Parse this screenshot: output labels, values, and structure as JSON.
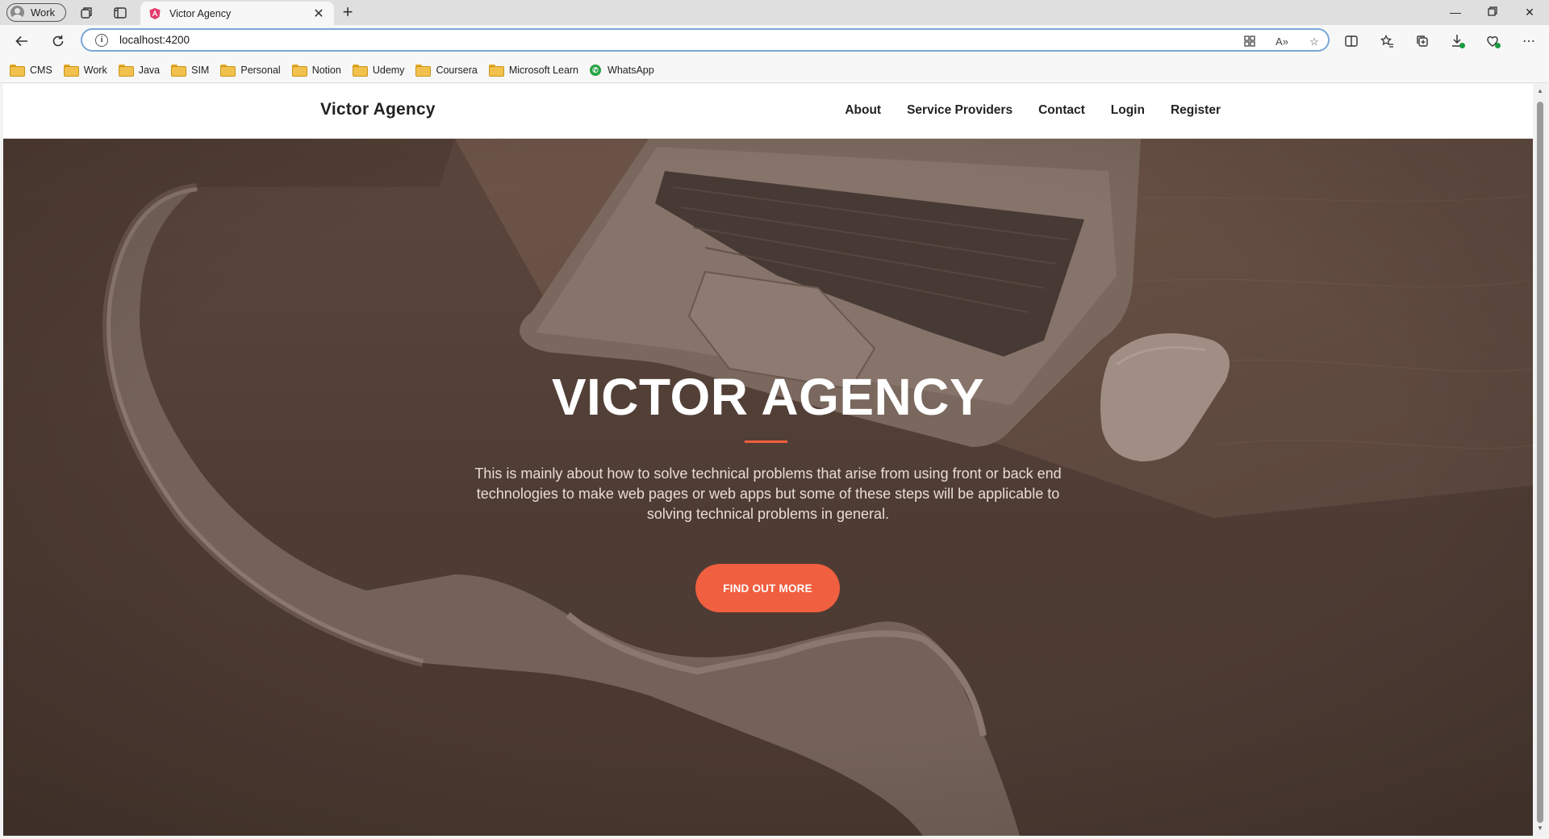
{
  "browser": {
    "profile_label": "Work",
    "tab_title": "Victor Agency",
    "address_url": "localhost:4200",
    "bookmarks": [
      "CMS",
      "Work",
      "Java",
      "SIM",
      "Personal",
      "Notion",
      "Udemy",
      "Coursera",
      "Microsoft Learn",
      "WhatsApp"
    ]
  },
  "site": {
    "brand": "Victor Agency",
    "nav": [
      "About",
      "Service Providers",
      "Contact",
      "Login",
      "Register"
    ]
  },
  "hero": {
    "title": "VICTOR AGENCY",
    "text": "This is mainly about how to solve technical problems that arise from using front or back end technologies to make web pages or web apps but some of these steps will be applicable to solving technical problems in general.",
    "cta_label": "FIND OUT MORE"
  },
  "colors": {
    "accent": "#f05f40",
    "hero_overlay": "#4e3c34",
    "address_focus": "#7aa7d8"
  }
}
